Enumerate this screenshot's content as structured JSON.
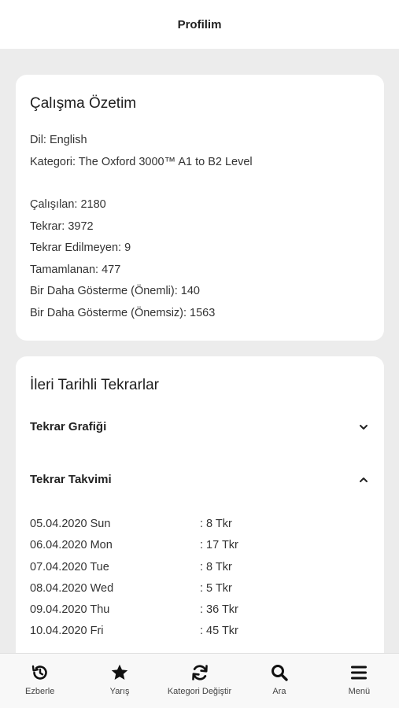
{
  "header": {
    "title": "Profilim"
  },
  "summary": {
    "title": "Çalışma Özetim",
    "language": "Dil: English",
    "category": "Kategori: The Oxford 3000™ A1 to B2 Level",
    "studied": "Çalışılan: 2180",
    "repeat": "Tekrar: 3972",
    "not_repeated": "Tekrar Edilmeyen: 9",
    "completed": "Tamamlanan: 477",
    "hide_important": "Bir Daha Gösterme (Önemli): 140",
    "hide_unimportant": "Bir Daha Gösterme (Önemsiz): 1563"
  },
  "future": {
    "title": "İleri Tarihli Tekrarlar",
    "graph_label": "Tekrar Grafiği",
    "calendar_label": "Tekrar Takvimi",
    "schedule": [
      {
        "date": "05.04.2020 Sun",
        "count": ": 8 Tkr"
      },
      {
        "date": "06.04.2020 Mon",
        "count": ": 17 Tkr"
      },
      {
        "date": "07.04.2020 Tue",
        "count": ": 8 Tkr"
      },
      {
        "date": "08.04.2020 Wed",
        "count": ": 5 Tkr"
      },
      {
        "date": "09.04.2020 Thu",
        "count": ": 36 Tkr"
      },
      {
        "date": "10.04.2020 Fri",
        "count": ": 45 Tkr"
      }
    ]
  },
  "tabs": {
    "memorize": "Ezberle",
    "race": "Yarış",
    "change_category": "Kategori Değiştir",
    "search": "Ara",
    "menu": "Menü"
  }
}
